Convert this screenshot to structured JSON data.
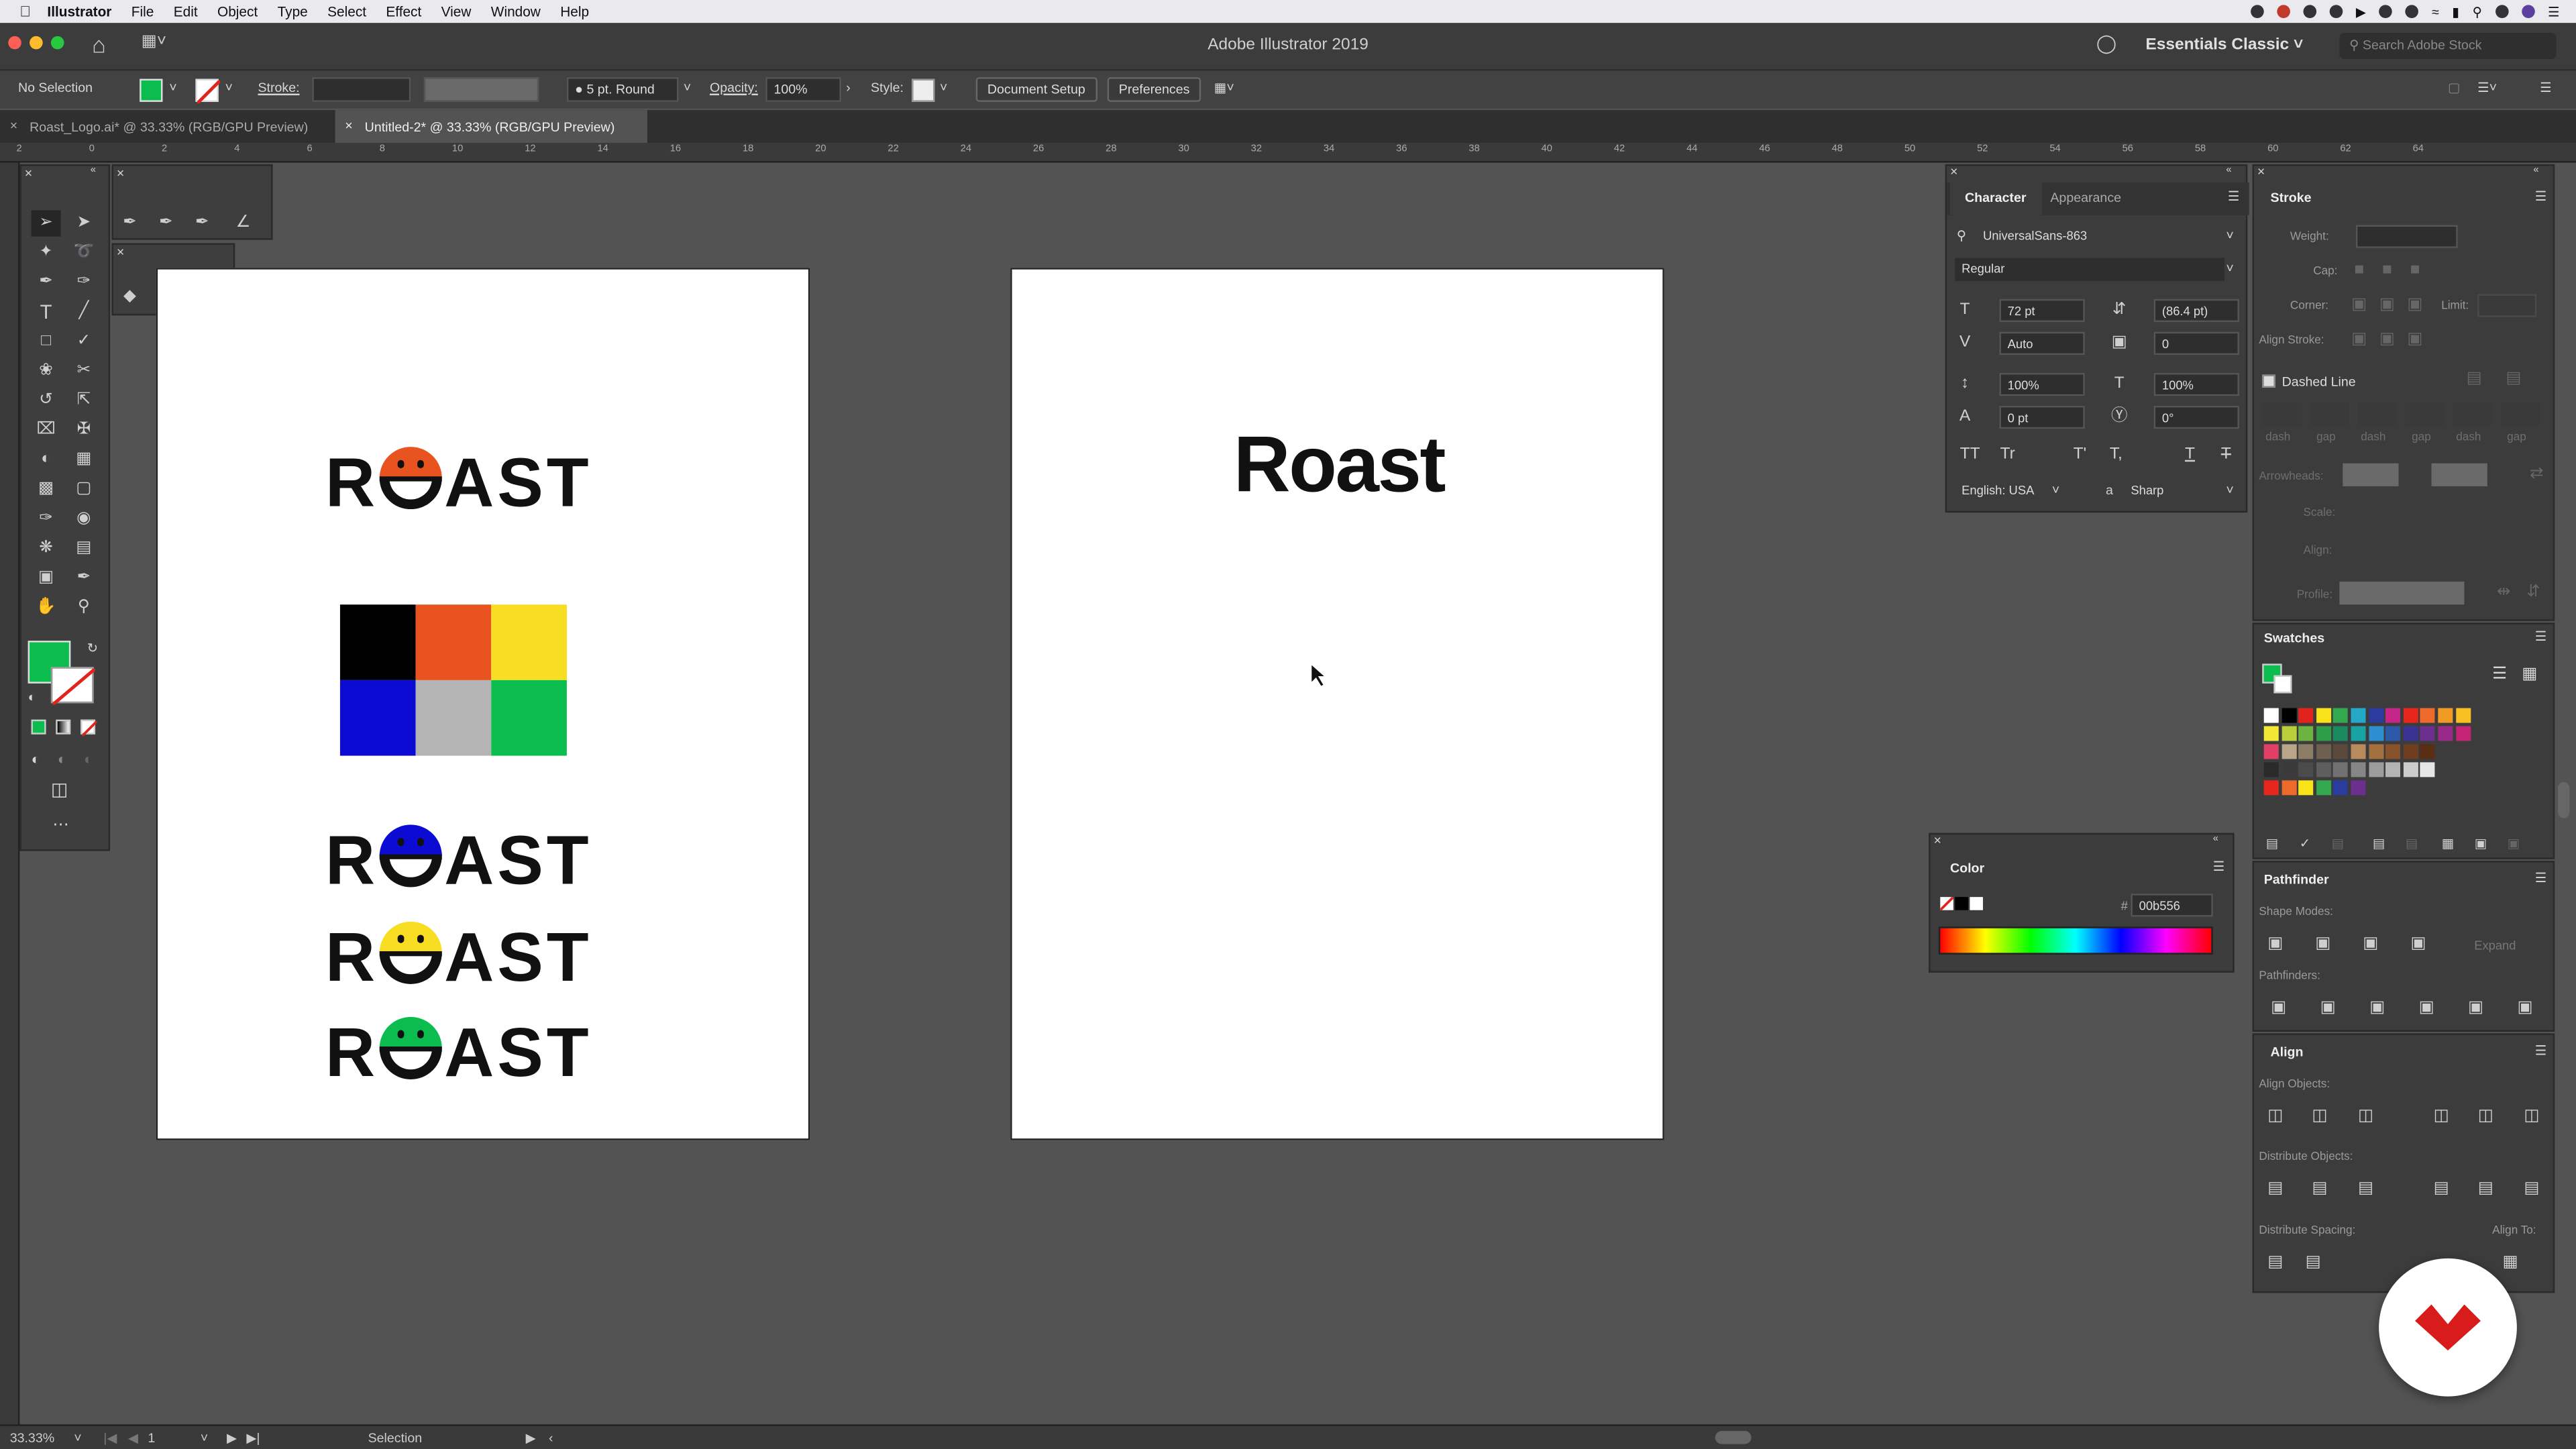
{
  "menubar": {
    "apple_icon": "apple-icon",
    "app_name": "Illustrator",
    "items": [
      "File",
      "Edit",
      "Object",
      "Type",
      "Select",
      "Effect",
      "View",
      "Window",
      "Help"
    ]
  },
  "titlebar": {
    "title": "Adobe Illustrator 2019",
    "workspace": "Essentials Classic",
    "stock_search_placeholder": "Search Adobe Stock"
  },
  "controlbar": {
    "selection": "No Selection",
    "fill_color": "#0bbd4f",
    "stroke_label": "Stroke:",
    "brush": "5 pt. Round",
    "opacity_label": "Opacity:",
    "opacity_value": "100%",
    "style_label": "Style:",
    "document_setup": "Document Setup",
    "preferences": "Preferences"
  },
  "tabs": [
    {
      "label": "Roast_Logo.ai* @ 33.33% (RGB/GPU Preview)",
      "active": false
    },
    {
      "label": "Untitled-2* @ 33.33% (RGB/GPU Preview)",
      "active": true
    }
  ],
  "ruler_ticks": [
    "2",
    "0",
    "2",
    "4",
    "6",
    "8",
    "10",
    "12",
    "14",
    "16",
    "18",
    "20",
    "22",
    "24",
    "26",
    "28",
    "30",
    "32",
    "34",
    "36",
    "38",
    "40",
    "42",
    "44",
    "46",
    "48",
    "50",
    "52",
    "54",
    "56",
    "58",
    "60",
    "62",
    "64"
  ],
  "artboard1": {
    "logo_text_prefix": "R",
    "logo_text_suffix": "AST",
    "palette": [
      "#000000",
      "#e8531f",
      "#f8de22",
      "#0b0bd3",
      "#b4b4b4",
      "#0bbd4f"
    ],
    "variant_colors": [
      "#e8531f",
      "#0b0bd3",
      "#f8de22",
      "#0bbd4f"
    ]
  },
  "artboard2": {
    "text": "Roast"
  },
  "character_panel": {
    "tab_character": "Character",
    "tab_appearance": "Appearance",
    "font_family": "UniversalSans-863",
    "font_style": "Regular",
    "size": "72 pt",
    "leading": "(86.4 pt)",
    "kerning": "Auto",
    "tracking": "0",
    "vscale": "100%",
    "hscale": "100%",
    "baseline": "0 pt",
    "rotation": "0°",
    "language": "English: USA",
    "antialias": "Sharp"
  },
  "stroke_panel": {
    "title": "Stroke",
    "weight_label": "Weight:",
    "cap_label": "Cap:",
    "corner_label": "Corner:",
    "limit_label": "Limit:",
    "align_label": "Align Stroke:",
    "dashed_label": "Dashed Line",
    "dash_labels": [
      "dash",
      "gap",
      "dash",
      "gap",
      "dash",
      "gap"
    ],
    "arrowheads_label": "Arrowheads:",
    "scale_label": "Scale:",
    "align2_label": "Align:",
    "profile_label": "Profile:"
  },
  "swatches_panel": {
    "title": "Swatches",
    "rows": [
      [
        "#ffffff",
        "#000000",
        "#e0241d",
        "#f8e31a",
        "#33a84f",
        "#23a8c8",
        "#2a3c9d",
        "#c42687",
        "#e8261e",
        "#ee6a2b",
        "#f29a26",
        "#f8c020"
      ],
      [
        "#f3e734",
        "#b9cf3a",
        "#6cb33f",
        "#2f9e48",
        "#1b8a5f",
        "#16a3a1",
        "#2d8ed0",
        "#2d5aa8",
        "#3a3394",
        "#6c2f8f",
        "#9a2a8a",
        "#c52476"
      ],
      [
        "#e23f67",
        "#b8a58a",
        "#8c7b65",
        "#6f5f4e",
        "#5b4a3c",
        "#b98a5c",
        "#a3703e",
        "#875229",
        "#6e3e1f",
        "#5a2e14"
      ],
      [
        "#2a2a2a",
        "#3a3a3a",
        "#4b4b4b",
        "#5e5e5e",
        "#717171",
        "#868686",
        "#9c9c9c",
        "#b4b4b4",
        "#cccccc",
        "#e6e6e6"
      ],
      [
        "#e8261e",
        "#ee6a2b",
        "#f8e31a",
        "#33a84f",
        "#2a3c9d",
        "#6c2f8f"
      ]
    ]
  },
  "color_panel": {
    "title": "Color",
    "hex_label": "#",
    "hex_value": "00b556"
  },
  "pathfinder_panel": {
    "title": "Pathfinder",
    "shape_modes": "Shape Modes:",
    "expand": "Expand",
    "pathfinders": "Pathfinders:"
  },
  "align_panel": {
    "title": "Align",
    "align_objects": "Align Objects:",
    "distribute_objects": "Distribute Objects:",
    "distribute_spacing": "Distribute Spacing:",
    "align_to": "Align To:"
  },
  "statusbar": {
    "zoom": "33.33%",
    "artboard_num": "1",
    "tool": "Selection"
  }
}
